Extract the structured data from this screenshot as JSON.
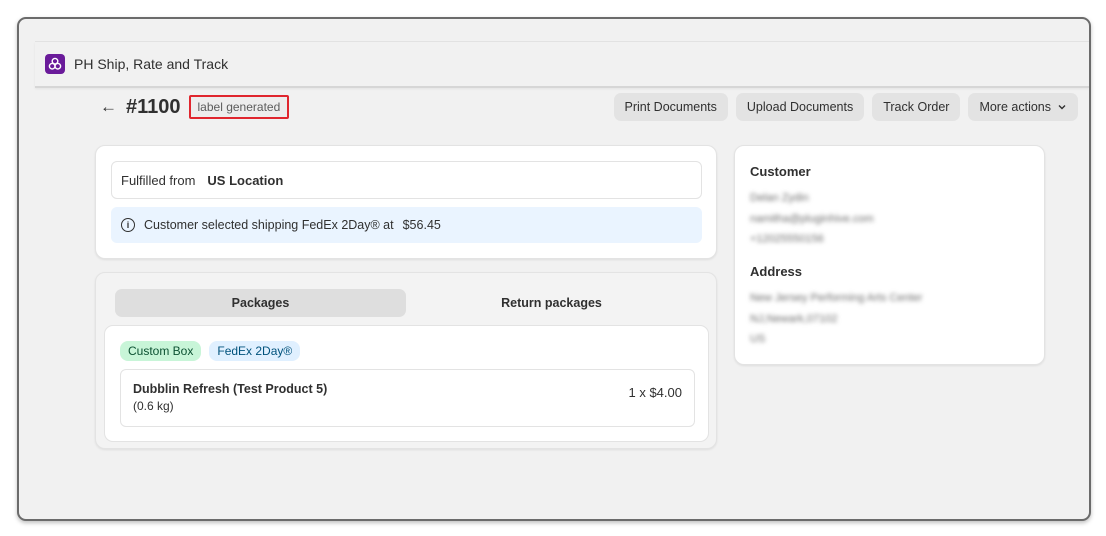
{
  "app": {
    "title": "PH Ship, Rate and Track",
    "icon": "app-logo-icon"
  },
  "order": {
    "back_icon": "back-arrow-icon",
    "number": "#1100",
    "status": "label generated"
  },
  "actions": {
    "print": "Print Documents",
    "upload": "Upload Documents",
    "track": "Track Order",
    "more": "More actions"
  },
  "fulfillment": {
    "label": "Fulfilled from",
    "location": "US Location",
    "banner_text": "Customer selected shipping FedEx 2Day® at",
    "banner_price": "$56.45"
  },
  "packages": {
    "tabs": [
      "Packages",
      "Return packages"
    ],
    "active_tab": "Packages",
    "tags": [
      "Custom Box",
      "FedEx 2Day®"
    ],
    "items": [
      {
        "name": "Dubblin Refresh (Test Product 5)",
        "weight": "(0.6 kg)",
        "qty_price": "1 x $4.00"
      }
    ]
  },
  "customer": {
    "title": "Customer",
    "name": "Delan Zydin",
    "email": "namitha@pluginhive.com",
    "phone": "+12025550156",
    "address_title": "Address",
    "address_line1": "New Jersey Performing Arts Center",
    "address_line2": "NJ,Newark,07102",
    "country": "US"
  },
  "colors": {
    "accent_purple": "#6a1b9a",
    "status_outline": "#e0262e",
    "tag_green": "#c8f5d8",
    "tag_blue": "#e0f0ff",
    "info_banner": "#eaf4ff"
  }
}
